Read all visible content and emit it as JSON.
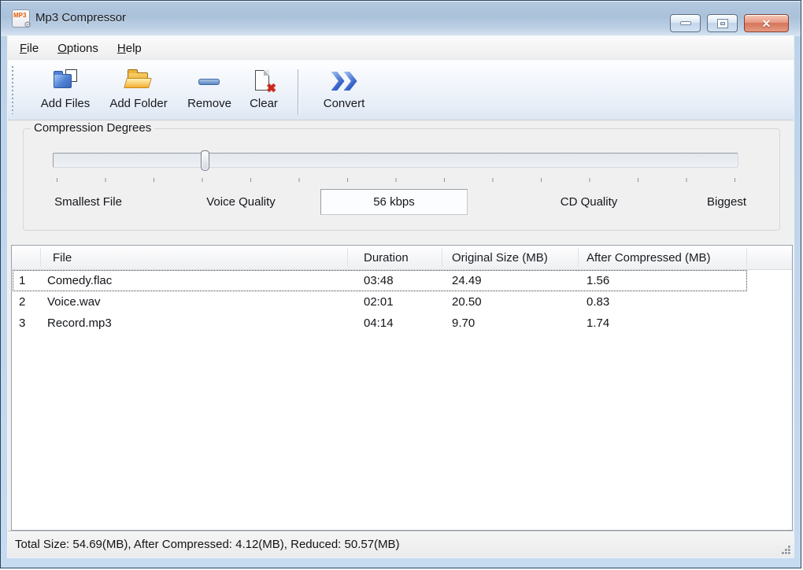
{
  "window": {
    "title": "Mp3 Compressor",
    "icons": {
      "mp3_badge": "MP3",
      "gear_glyph": "⚙",
      "close_glyph": "✕"
    }
  },
  "menu": {
    "items": [
      {
        "hot": "F",
        "rest": "ile"
      },
      {
        "hot": "O",
        "rest": "ptions"
      },
      {
        "hot": "H",
        "rest": "elp"
      }
    ]
  },
  "toolbar": {
    "add_files": "Add Files",
    "add_folder": "Add Folder",
    "remove": "Remove",
    "clear": "Clear",
    "convert": "Convert"
  },
  "compression": {
    "group_title": "Compression Degrees",
    "slider": {
      "value_label": "56 kbps",
      "position_percent": 21.5,
      "tick_count": 15
    },
    "scale_labels": [
      "Smallest File",
      "Voice Quality",
      "CD Quality",
      "Biggest"
    ]
  },
  "table": {
    "headers": {
      "file": "File",
      "duration": "Duration",
      "original": "Original Size (MB)",
      "after": "After Compressed (MB)"
    },
    "rows": [
      {
        "num": "1",
        "file": "Comedy.flac",
        "duration": "03:48",
        "original": "24.49",
        "after": "1.56",
        "selected": true
      },
      {
        "num": "2",
        "file": "Voice.wav",
        "duration": "02:01",
        "original": "20.50",
        "after": "0.83",
        "selected": false
      },
      {
        "num": "3",
        "file": "Record.mp3",
        "duration": "04:14",
        "original": "9.70",
        "after": "1.74",
        "selected": false
      }
    ]
  },
  "status": {
    "summary": "Total Size: 54.69(MB), After Compressed: 4.12(MB), Reduced: 50.57(MB)"
  },
  "colors": {
    "titlebar_blue": "#aac1da",
    "border_blue": "#bcd2e8",
    "toolbar_blue": "#e6edf7",
    "folder_blue": "#4e81d4",
    "folder_yellow": "#f3ae33",
    "convert_blue": "#2f5dc6",
    "close_red": "#d5755a",
    "clear_badge_red": "#cf281c",
    "client_gray": "#f0f0f0"
  }
}
